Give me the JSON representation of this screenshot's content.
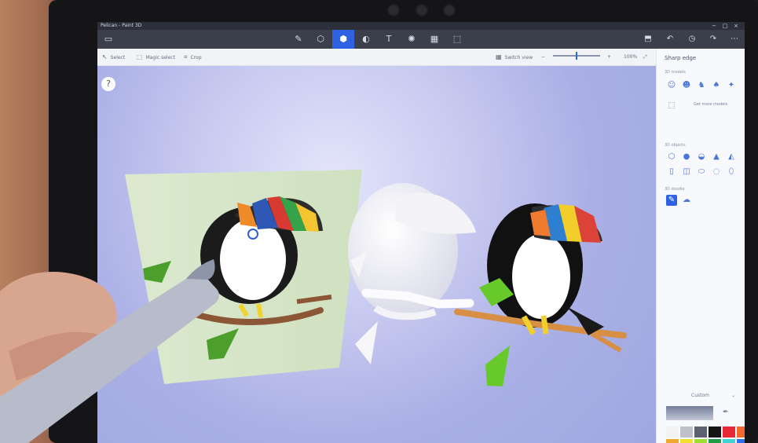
{
  "window": {
    "title": "Pelican - Paint 3D"
  },
  "toolbar": {
    "select": "Select",
    "magic_select": "Magic select",
    "crop": "Crop",
    "switch_view": "Switch view",
    "zoom": "100%"
  },
  "panel": {
    "title": "Sharp edge",
    "models_label": "3D models",
    "get_more_models": "Get more models",
    "objects_label": "3D objects",
    "doodle_label": "3D doodle",
    "custom_label": "Custom"
  },
  "colors": {
    "accent": "#2f62e2",
    "menu_bar": "#3b3e4b",
    "panel_background": "#f8f9fd"
  }
}
